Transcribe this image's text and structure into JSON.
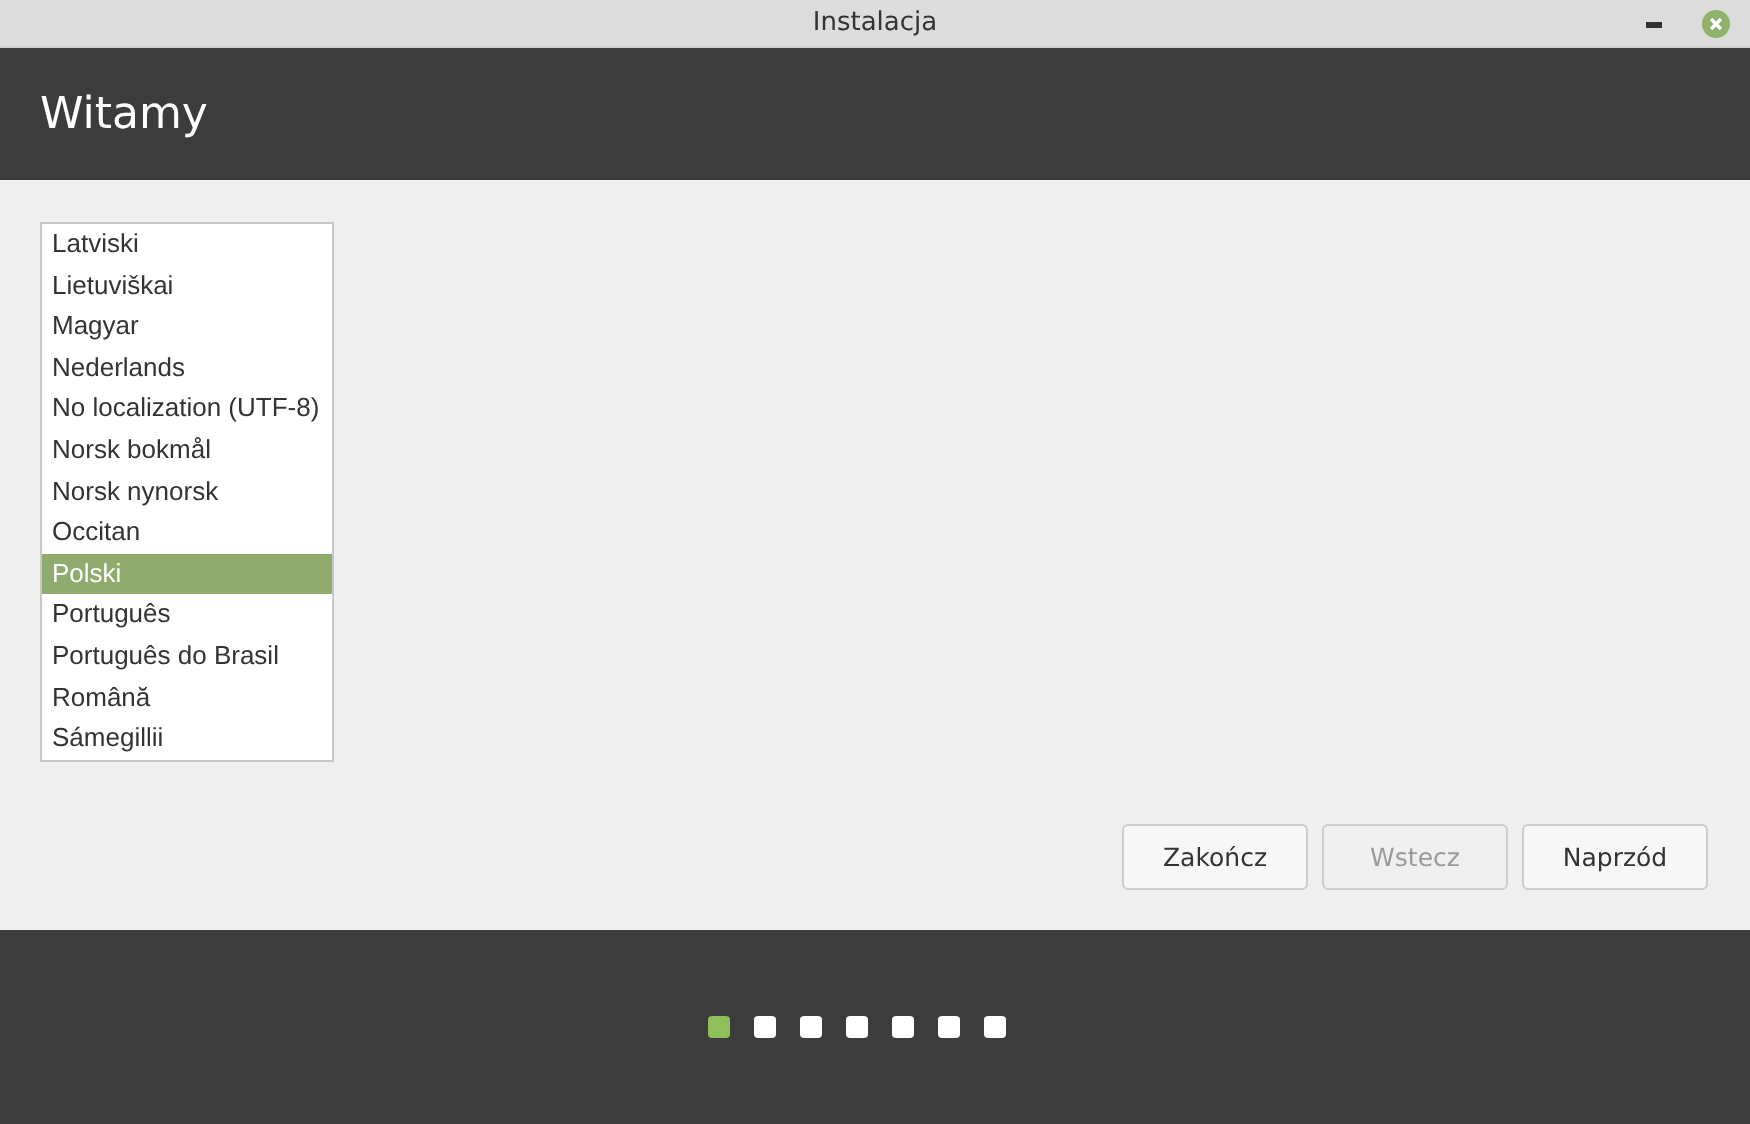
{
  "window": {
    "title": "Instalacja"
  },
  "header": {
    "title": "Witamy"
  },
  "languages": [
    {
      "label": "Latviski",
      "selected": false
    },
    {
      "label": "Lietuviškai",
      "selected": false
    },
    {
      "label": "Magyar",
      "selected": false
    },
    {
      "label": "Nederlands",
      "selected": false
    },
    {
      "label": "No localization (UTF-8)",
      "selected": false
    },
    {
      "label": "Norsk bokmål",
      "selected": false
    },
    {
      "label": "Norsk nynorsk",
      "selected": false
    },
    {
      "label": "Occitan",
      "selected": false
    },
    {
      "label": "Polski",
      "selected": true
    },
    {
      "label": "Português",
      "selected": false
    },
    {
      "label": "Português do Brasil",
      "selected": false
    },
    {
      "label": "Română",
      "selected": false
    },
    {
      "label": "Sámegillii",
      "selected": false
    }
  ],
  "buttons": [
    {
      "label": "Zakończ",
      "disabled": false
    },
    {
      "label": "Wstecz",
      "disabled": true
    },
    {
      "label": "Naprzód",
      "disabled": false
    }
  ],
  "steps": [
    {
      "selected": true
    },
    {
      "selected": false
    },
    {
      "selected": false
    },
    {
      "selected": false
    },
    {
      "selected": false
    },
    {
      "selected": false
    },
    {
      "selected": false
    }
  ]
}
